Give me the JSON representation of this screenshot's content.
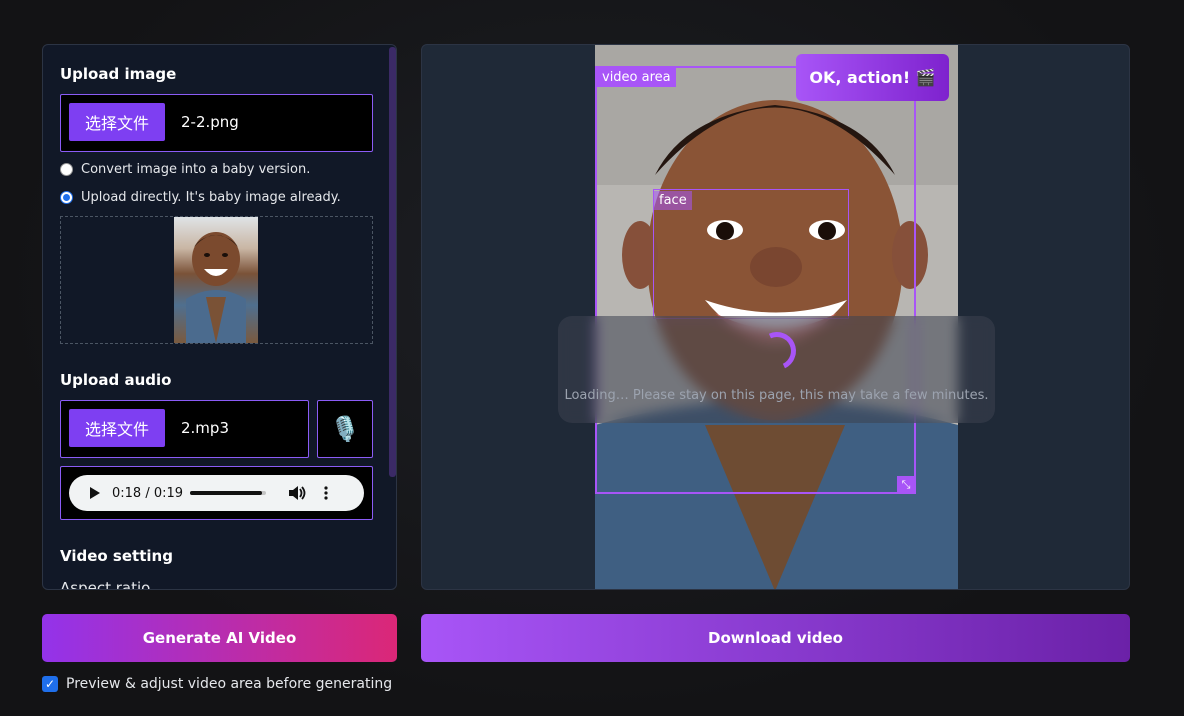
{
  "left": {
    "upload_image_title": "Upload image",
    "image_file_button": "选择文件",
    "image_file_name": "2-2.png",
    "radio_convert_label": "Convert image into a baby version.",
    "radio_direct_label": "Upload directly. It's baby image already.",
    "upload_audio_title": "Upload audio",
    "audio_file_button": "选择文件",
    "audio_file_name": "2.mp3",
    "audio_time": "0:18 / 0:19",
    "audio_progress": 0.95,
    "video_setting_title": "Video setting",
    "aspect_ratio_label": "Aspect ratio"
  },
  "preview": {
    "video_area_tag": "video area",
    "face_tag": "face",
    "ok_button": "OK, action! 🎬",
    "loading_text": "Loading… Please stay on this page, this may take a few minutes."
  },
  "actions": {
    "generate_label": "Generate AI Video",
    "download_label": "Download video",
    "preview_checkbox_label": "Preview & adjust video area before generating",
    "preview_checkbox_checked": true
  },
  "colors": {
    "accent": "#a855f7",
    "button_purple": "#7e3ff2",
    "generate_gradient_end": "#db2777"
  },
  "icons": {
    "mic": "microphone-icon",
    "play": "play-icon",
    "volume": "volume-icon",
    "more": "more-vertical-icon",
    "resize": "resize-icon",
    "spinner": "spinner-icon"
  }
}
